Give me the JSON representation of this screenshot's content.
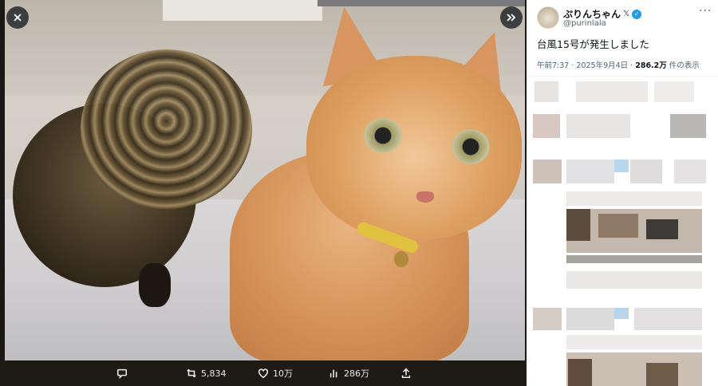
{
  "viewer": {
    "close_icon": "close-icon",
    "expand_icon": "expand-icon",
    "actions": {
      "reply": {
        "icon": "reply-icon",
        "count": ""
      },
      "retweet": {
        "icon": "retweet-icon",
        "count": "5,834"
      },
      "like": {
        "icon": "heart-icon",
        "count": "10万"
      },
      "views": {
        "icon": "views-icon",
        "count": "286万"
      },
      "share": {
        "icon": "share-icon",
        "count": ""
      }
    }
  },
  "tweet": {
    "display_name": "ぷりんちゃん",
    "x_mark": "𝕏",
    "handle": "@purinlala",
    "text": "台風15号が発生しました",
    "time": "午前7:37 · 2025年9月4日 · ",
    "views_count": "286.2万",
    "views_label": " 件の表示"
  },
  "colors": {
    "verified": "#1d9bf0",
    "text_primary": "#0f1419",
    "text_secondary": "#536471"
  }
}
